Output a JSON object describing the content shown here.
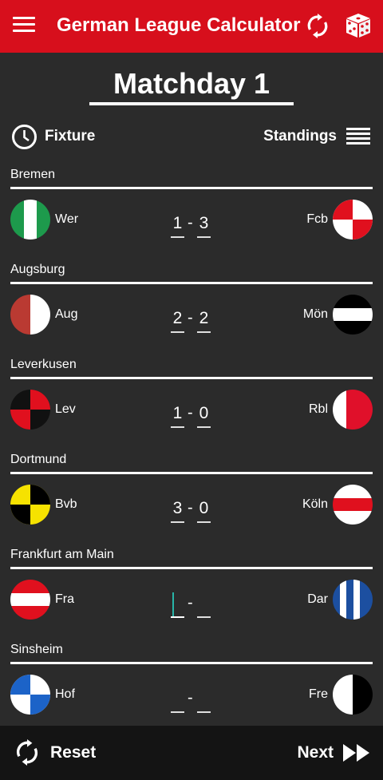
{
  "app": {
    "title": "German League Calculator"
  },
  "matchday": {
    "title": "Matchday 1"
  },
  "tabs": {
    "fixture": "Fixture",
    "standings": "Standings"
  },
  "matches": [
    {
      "venue": "Bremen",
      "home": "Wer",
      "away": "Fcb",
      "home_goals": "1",
      "away_goals": "3"
    },
    {
      "venue": "Augsburg",
      "home": "Aug",
      "away": "Mön",
      "home_goals": "2",
      "away_goals": "2"
    },
    {
      "venue": "Leverkusen",
      "home": "Lev",
      "away": "Rbl",
      "home_goals": "1",
      "away_goals": "0"
    },
    {
      "venue": "Dortmund",
      "home": "Bvb",
      "away": "Köln",
      "home_goals": "3",
      "away_goals": "0"
    },
    {
      "venue": "Frankfurt am Main",
      "home": "Fra",
      "away": "Dar",
      "home_goals": "",
      "away_goals": ""
    },
    {
      "venue": "Sinsheim",
      "home": "Hof",
      "away": "Fre",
      "home_goals": "",
      "away_goals": ""
    }
  ],
  "score_separator": "-",
  "footer": {
    "reset": "Reset",
    "next": "Next"
  },
  "colors": {
    "brand": "#d70f1c",
    "background": "#2b2b2b",
    "footer": "#141414",
    "input_cursor": "#28b5a8"
  },
  "icons": {
    "menu": "hamburger-icon",
    "sync": "sync-icon",
    "dice": "dice-icon",
    "fixture": "clock-icon",
    "standings": "list-lines-icon",
    "reset": "refresh-icon",
    "next": "fast-forward-icon"
  }
}
